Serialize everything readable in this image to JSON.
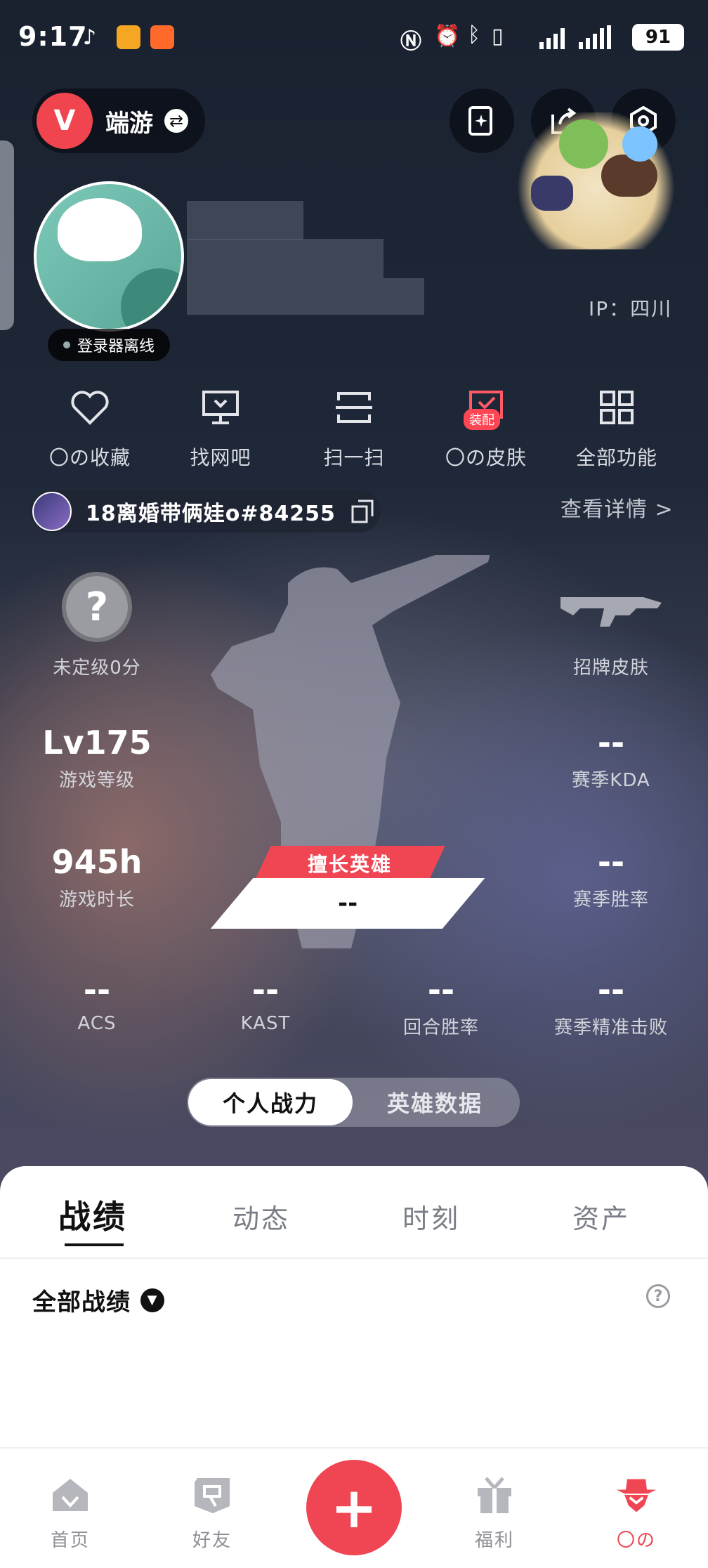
{
  "status_bar": {
    "time": "9:17",
    "battery": "91"
  },
  "header": {
    "brand_name": "端游",
    "brand_logo": "V"
  },
  "profile": {
    "online_status": "登录器离线",
    "ip": "IP：四川"
  },
  "quick_functions": [
    {
      "label": "〇の收藏",
      "icon": "heart-icon"
    },
    {
      "label": "找网吧",
      "icon": "monitor-icon"
    },
    {
      "label": "扫一扫",
      "icon": "scan-icon"
    },
    {
      "label": "〇の皮肤",
      "icon": "skin-icon",
      "badge": "装配"
    },
    {
      "label": "全部功能",
      "icon": "grid-icon"
    }
  ],
  "account": {
    "name": "18离婚带俩娃o#84255",
    "detail_link": "查看详情 >"
  },
  "stats": {
    "rank": {
      "symbol": "?",
      "label": "未定级0分"
    },
    "signature_skin": {
      "label": "招牌皮肤"
    },
    "level": {
      "value": "Lv175",
      "label": "游戏等级"
    },
    "season_kda": {
      "value": "--",
      "label": "赛季KDA"
    },
    "playtime": {
      "value": "945h",
      "label": "游戏时长"
    },
    "season_winrate": {
      "value": "--",
      "label": "赛季胜率"
    },
    "best_hero": {
      "tag": "擅长英雄",
      "value": "--"
    },
    "acs": {
      "value": "--",
      "label": "ACS"
    },
    "kast": {
      "value": "--",
      "label": "KAST"
    },
    "round_winrate": {
      "value": "--",
      "label": "回合胜率"
    },
    "season_headshot": {
      "value": "--",
      "label": "赛季精准击败"
    }
  },
  "toggle": {
    "personal": "个人战力",
    "hero_data": "英雄数据"
  },
  "tabs": [
    "战绩",
    "动态",
    "时刻",
    "资产"
  ],
  "record_filter": {
    "label": "全部战绩"
  },
  "bottom_nav": [
    {
      "label": "首页",
      "icon": "home-icon"
    },
    {
      "label": "好友",
      "icon": "friends-icon"
    },
    {
      "label": "福利",
      "icon": "gift-icon"
    },
    {
      "label": "〇の",
      "icon": "profile-icon"
    }
  ],
  "colors": {
    "accent": "#f04553",
    "sheet": "#ffffff"
  }
}
